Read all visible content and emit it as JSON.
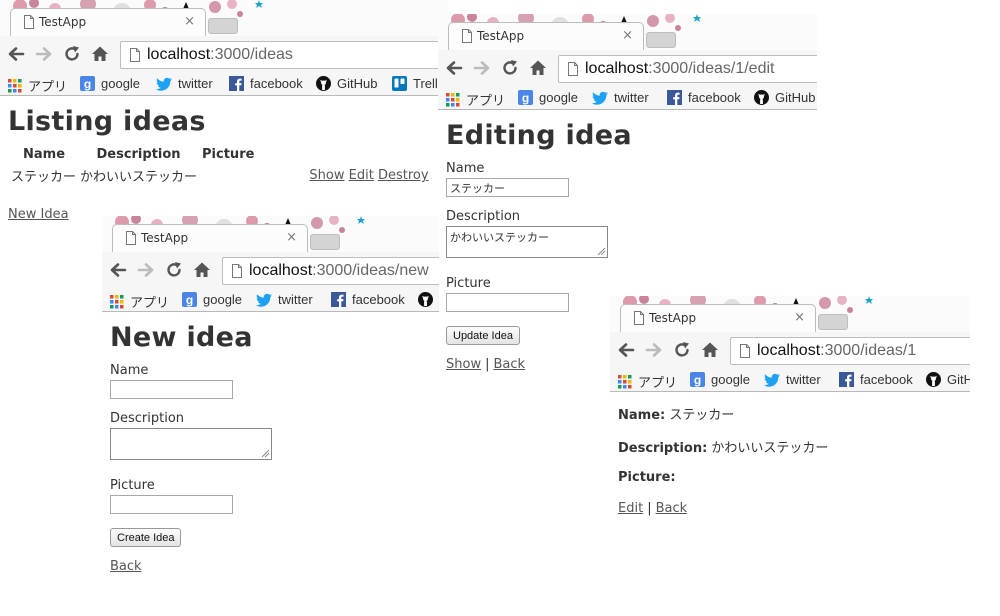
{
  "browser": {
    "tab_title": "TestApp",
    "tab_close": "×",
    "bookmarks": {
      "apps": "アプリ",
      "google": "google",
      "twitter": "twitter",
      "facebook": "facebook",
      "github": "GitHub",
      "trello": "Trello"
    }
  },
  "window_index": {
    "url_host": "localhost",
    "url_path": ":3000/ideas",
    "heading": "Listing ideas",
    "table": {
      "columns": [
        "Name",
        "Description",
        "Picture"
      ],
      "rows": [
        {
          "name": "ステッカー",
          "description": "かわいいステッカー",
          "picture": ""
        }
      ],
      "row_actions": [
        "Show",
        "Edit",
        "Destroy"
      ]
    },
    "new_link": "New Idea"
  },
  "window_edit": {
    "url_host": "localhost",
    "url_path": ":3000/ideas/1/edit",
    "heading": "Editing idea",
    "name_label": "Name",
    "name_value": "ステッカー",
    "description_label": "Description",
    "description_value": "かわいいステッカー",
    "picture_label": "Picture",
    "picture_value": "",
    "submit_label": "Update Idea",
    "show_link": "Show",
    "separator": "|",
    "back_link": "Back"
  },
  "window_new": {
    "url_host": "localhost",
    "url_path": ":3000/ideas/new",
    "heading": "New idea",
    "name_label": "Name",
    "description_label": "Description",
    "picture_label": "Picture",
    "submit_label": "Create Idea",
    "back_link": "Back"
  },
  "window_show": {
    "url_host": "localhost",
    "url_path": ":3000/ideas/1",
    "name_label": "Name:",
    "name_value": "ステッカー",
    "description_label": "Description:",
    "description_value": "かわいいステッカー",
    "picture_label": "Picture:",
    "picture_value": "",
    "edit_link": "Edit",
    "separator": "|",
    "back_link": "Back"
  },
  "colors": {
    "text": "#333333",
    "link": "#555555",
    "chrome_toolbar": "#f6f6f6",
    "chrome_border": "#b8b8b8",
    "google_blue": "#4a86e8",
    "twitter_blue": "#1da1f2",
    "facebook_blue": "#3b5998",
    "trello_blue": "#0079bf"
  },
  "icons": {
    "back": "arrow-left-icon",
    "forward": "arrow-right-icon",
    "reload": "reload-icon",
    "home": "home-icon",
    "page": "page-icon",
    "apps": "apps-grid-icon",
    "google": "google-icon",
    "twitter": "twitter-bird-icon",
    "facebook": "facebook-icon",
    "github": "github-icon",
    "trello": "trello-icon"
  }
}
